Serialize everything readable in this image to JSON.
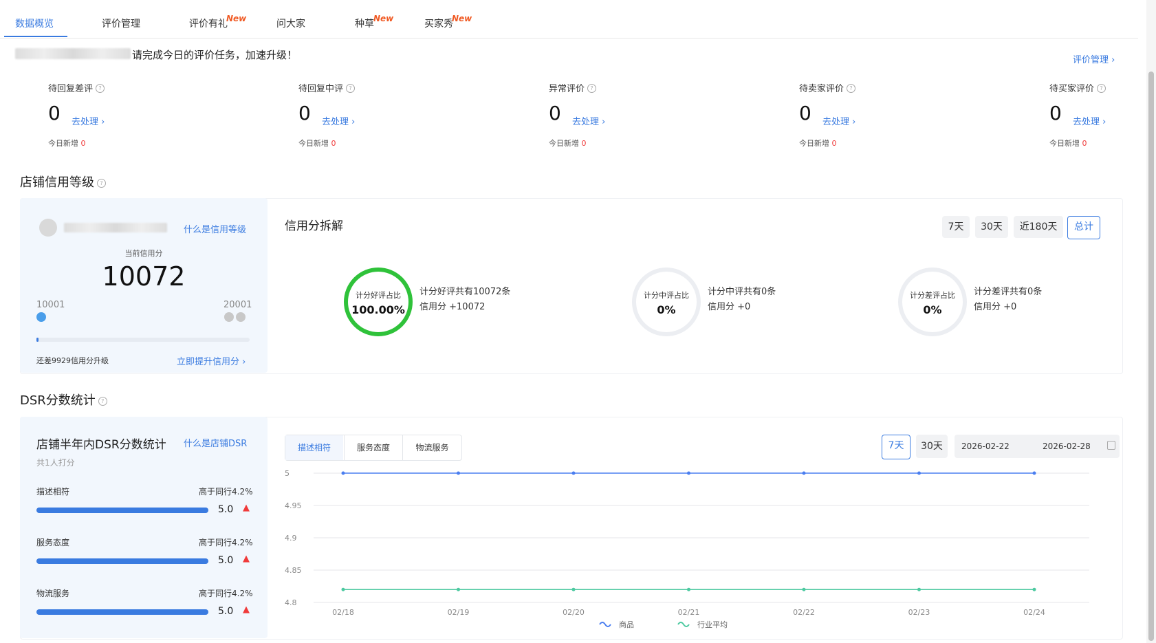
{
  "tabs": [
    {
      "label": "数据概览",
      "active": true
    },
    {
      "label": "评价管理",
      "active": false
    },
    {
      "label": "评价有礼",
      "active": false,
      "badge": "New"
    },
    {
      "label": "问大家",
      "active": false
    },
    {
      "label": "种草",
      "active": false,
      "badge": "New"
    },
    {
      "label": "买家秀",
      "active": false,
      "badge": "New"
    }
  ],
  "notice": {
    "text": "请完成今日的评价任务，加速升级！",
    "manage_link": "评价管理 ›"
  },
  "stats": [
    {
      "title": "待回复差评",
      "value": "0",
      "action": "去处理 ›",
      "today_label": "今日新增",
      "today_value": "0"
    },
    {
      "title": "待回复中评",
      "value": "0",
      "action": "去处理 ›",
      "today_label": "今日新增",
      "today_value": "0"
    },
    {
      "title": "异常评价",
      "value": "0",
      "action": "去处理 ›",
      "today_label": "今日新增",
      "today_value": "0"
    },
    {
      "title": "待卖家评价",
      "value": "0",
      "action": "去处理 ›",
      "today_label": "今日新增",
      "today_value": "0"
    },
    {
      "title": "待买家评价",
      "value": "0",
      "action": "去处理 ›",
      "today_label": "今日新增",
      "today_value": "0"
    }
  ],
  "credit": {
    "section_title": "店铺信用等级",
    "what_link": "什么是信用等级",
    "current_label": "当前信用分",
    "current_value": "10072",
    "min_label": "10001",
    "max_label": "20001",
    "progress_fraction": 0.0072,
    "remaining_text": "还差9929信用分升级",
    "upgrade_link": "立即提升信用分 ›",
    "breakdown_title": "信用分拆解",
    "ranges": [
      {
        "label": "7天",
        "active": false
      },
      {
        "label": "30天",
        "active": false
      },
      {
        "label": "近180天",
        "active": false
      },
      {
        "label": "总计",
        "active": true
      }
    ],
    "rings": [
      {
        "label": "计分好评占比",
        "value": "100.00%",
        "line1": "计分好评共有10072条",
        "line2": "信用分 +10072",
        "color": "#2fc23a",
        "fraction": 1.0
      },
      {
        "label": "计分中评占比",
        "value": "0%",
        "line1": "计分中评共有0条",
        "line2": "信用分 +0",
        "color": "#eceef2",
        "fraction": 0
      },
      {
        "label": "计分差评占比",
        "value": "0%",
        "line1": "计分差评共有0条",
        "line2": "信用分 +0",
        "color": "#eceef2",
        "fraction": 0
      }
    ]
  },
  "dsr": {
    "section_title": "DSR分数统计",
    "card_title": "店铺半年内DSR分数统计",
    "what_link": "什么是店铺DSR",
    "raters": "共1人打分",
    "rows": [
      {
        "label": "描述相符",
        "compare": "高于同行4.2%",
        "score": "5.0",
        "fraction": 1.0
      },
      {
        "label": "服务态度",
        "compare": "高于同行4.2%",
        "score": "5.0",
        "fraction": 1.0
      },
      {
        "label": "物流服务",
        "compare": "高于同行4.2%",
        "score": "5.0",
        "fraction": 1.0
      }
    ],
    "segments": [
      {
        "label": "描述相符",
        "active": true
      },
      {
        "label": "服务态度",
        "active": false
      },
      {
        "label": "物流服务",
        "active": false
      }
    ],
    "ranges": [
      {
        "label": "7天",
        "active": true
      },
      {
        "label": "30天",
        "active": false
      }
    ],
    "date_start": "2026-02-22",
    "date_end": "2026-02-28"
  },
  "chart_data": {
    "type": "line",
    "x": [
      "02/18",
      "02/19",
      "02/20",
      "02/21",
      "02/22",
      "02/23",
      "02/24"
    ],
    "y_ticks": [
      "5",
      "4.95",
      "4.9",
      "4.85",
      "4.8"
    ],
    "ylim": [
      4.8,
      5.0
    ],
    "series": [
      {
        "name": "商品",
        "values": [
          5,
          5,
          5,
          5,
          5,
          5,
          5
        ],
        "color": "#4a7ef0"
      },
      {
        "name": "行业平均",
        "values": [
          4.82,
          4.82,
          4.82,
          4.82,
          4.82,
          4.82,
          4.82
        ],
        "color": "#4cc9a0"
      }
    ],
    "legend_position": "bottom"
  }
}
